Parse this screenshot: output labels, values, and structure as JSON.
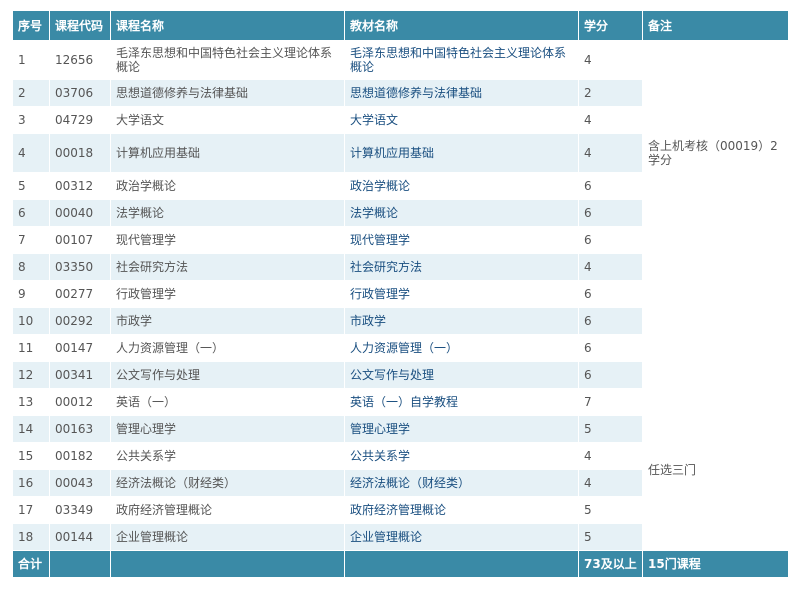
{
  "header": {
    "no": "序号",
    "code": "课程代码",
    "name": "课程名称",
    "book": "教材名称",
    "credit": "学分",
    "note": "备注"
  },
  "rows": [
    {
      "no": "1",
      "code": "12656",
      "name": "毛泽东思想和中国特色社会主义理论体系概论",
      "book": "毛泽东思想和中国特色社会主义理论体系概论",
      "credit": "4"
    },
    {
      "no": "2",
      "code": "03706",
      "name": "思想道德修养与法律基础",
      "book": "思想道德修养与法律基础",
      "credit": "2"
    },
    {
      "no": "3",
      "code": "04729",
      "name": "大学语文",
      "book": "大学语文",
      "credit": "4"
    },
    {
      "no": "4",
      "code": "00018",
      "name": "计算机应用基础",
      "book": "计算机应用基础",
      "credit": "4"
    },
    {
      "no": "5",
      "code": "00312",
      "name": "政治学概论",
      "book": "政治学概论",
      "credit": "6"
    },
    {
      "no": "6",
      "code": "00040",
      "name": "法学概论",
      "book": "法学概论",
      "credit": "6"
    },
    {
      "no": "7",
      "code": "00107",
      "name": "现代管理学",
      "book": "现代管理学",
      "credit": "6"
    },
    {
      "no": "8",
      "code": "03350",
      "name": "社会研究方法",
      "book": "社会研究方法",
      "credit": "4"
    },
    {
      "no": "9",
      "code": "00277",
      "name": "行政管理学",
      "book": "行政管理学",
      "credit": "6"
    },
    {
      "no": "10",
      "code": "00292",
      "name": "市政学",
      "book": "市政学",
      "credit": "6"
    },
    {
      "no": "11",
      "code": "00147",
      "name": "人力资源管理（一）",
      "book": "人力资源管理（一）",
      "credit": "6"
    },
    {
      "no": "12",
      "code": "00341",
      "name": "公文写作与处理",
      "book": "公文写作与处理",
      "credit": "6"
    },
    {
      "no": "13",
      "code": "00012",
      "name": "英语（一）",
      "book": "英语（一）自学教程",
      "credit": "7"
    },
    {
      "no": "14",
      "code": "00163",
      "name": "管理心理学",
      "book": "管理心理学",
      "credit": "5"
    },
    {
      "no": "15",
      "code": "00182",
      "name": "公共关系学",
      "book": "公共关系学",
      "credit": "4"
    },
    {
      "no": "16",
      "code": "00043",
      "name": "经济法概论（财经类）",
      "book": "经济法概论（财经类）",
      "credit": "4"
    },
    {
      "no": "17",
      "code": "03349",
      "name": "政府经济管理概论",
      "book": "政府经济管理概论",
      "credit": "5"
    },
    {
      "no": "18",
      "code": "00144",
      "name": "企业管理概论",
      "book": "企业管理概论",
      "credit": "5"
    }
  ],
  "notes": {
    "computer": "含上机考核（00019）2学分",
    "elective": "任选三门"
  },
  "footer": {
    "label": "合计",
    "credit_total": "73及以上",
    "course_total": "15门课程"
  }
}
